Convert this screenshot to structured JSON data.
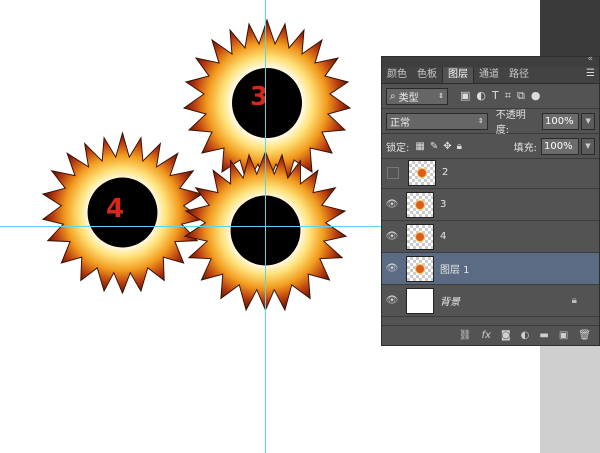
{
  "canvas": {
    "bursts": [
      {
        "label": "3"
      },
      {
        "label": "4"
      },
      {
        "label": ""
      }
    ]
  },
  "panel": {
    "tabs": [
      "颜色",
      "色板",
      "图层",
      "通道",
      "路径"
    ],
    "active_tab": "图层",
    "filter": {
      "label": "类型"
    },
    "blend_mode": "正常",
    "opacity_label": "不透明度:",
    "opacity_value": "100%",
    "lock_label": "锁定:",
    "fill_label": "填充:",
    "fill_value": "100%",
    "layers": [
      {
        "name": "2",
        "visible": false
      },
      {
        "name": "3",
        "visible": true
      },
      {
        "name": "4",
        "visible": true
      },
      {
        "name": "图层 1",
        "visible": true,
        "selected": true
      },
      {
        "name": "背景",
        "visible": true,
        "locked": true
      }
    ]
  },
  "colors": {
    "accent_selected": "#5a6b83",
    "guide": "#58d5e8",
    "number": "#d9261c"
  }
}
